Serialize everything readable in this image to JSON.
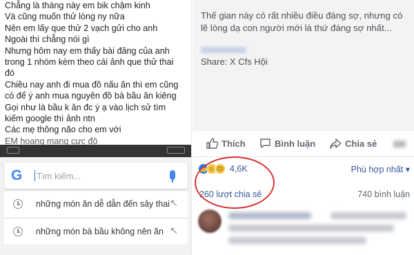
{
  "left_panel": {
    "post_lines": [
      "Chẳng là tháng này em bik chậm kinh",
      "Và cũng muốn thử lòng ny nữa",
      "Nên em lấy que thử 2 vạch gửi cho anh",
      "Ngoài thì chẳng nói gì",
      "Nhưng hôm nay em thấy bài đăng của anh",
      "trong 1 nhóm kèm theo cái ảnh que thử thai",
      "đó",
      "Chiều nay anh đi mua đồ nấu ăn thì em cũng",
      "có để ý anh mua nguyên đồ bà bầu ăn kiêng",
      "Gọi như là bầu k ăn đc ý ạ  vào lịch sử tìm",
      "kiếm google  thì ảnh ntn",
      "Các mẹ thông não cho em với",
      "EM hoang mang cực độ"
    ],
    "search": {
      "logo": "G",
      "placeholder": "Tìm kiếm...",
      "suggestions": [
        "những món ăn dễ dẫn đến sảy thai",
        "những món bà bầu không nên ăn"
      ]
    }
  },
  "right_panel": {
    "quote": "Thế gian này có rất nhiều điều đáng sợ, nhưng có lẽ lòng dạ con người mới là thứ đáng sợ nhất...",
    "share_line": "Share: X Cfs Hội",
    "actions": {
      "like": "Thích",
      "comment": "Bình luận",
      "share": "Chia sẻ"
    },
    "reaction_count": "4,6K",
    "sort_label": "Phù hợp nhất",
    "shares_count": "260 lượt chia sẻ",
    "comments_count": "740 bình luận"
  },
  "colors": {
    "fb_link": "#385898",
    "google_blue": "#4285f4",
    "highlight_circle": "#d63333"
  }
}
